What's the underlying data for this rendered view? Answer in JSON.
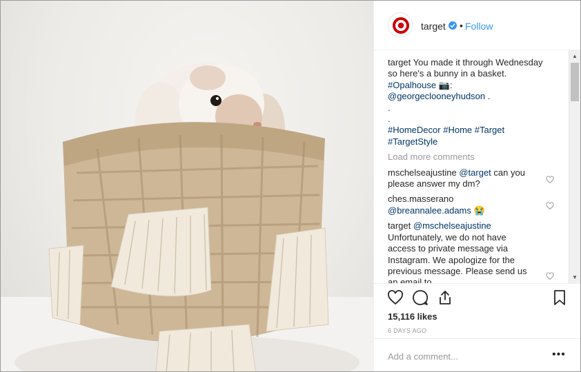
{
  "post": {
    "image_description_icon": "bunny-in-basket-photo"
  },
  "header": {
    "username": "target",
    "dot": "•",
    "follow_label": "Follow",
    "avatar_icon": "target-logo-icon",
    "verified_icon": "verified-badge-icon"
  },
  "caption": {
    "username": "target",
    "line1": "You made it through Wednesday",
    "line2": "so here's a bunny in a basket.",
    "tag_opalhouse": "#Opalhouse",
    "camera": "📷:",
    "mention_photographer": "@georgeclooneyhudson",
    "period": ".",
    "dot1": ".",
    "dot2": ".",
    "tag_homedecor": "#HomeDecor",
    "tag_home": "#Home",
    "tag_target": "#Target",
    "tag_targetstyle": "#TargetStyle"
  },
  "load_more_label": "Load more comments",
  "comments": [
    {
      "username": "mschelseajustine",
      "mention": "@target",
      "text": "can you",
      "text2": "please answer my dm?"
    },
    {
      "username": "ches.masserano",
      "mention": "@breannalee.adams",
      "emoji": "😭"
    },
    {
      "username": "target",
      "mention": "@mschelseajustine",
      "lines": [
        "Unfortunately, we do not have",
        "access to private message via",
        "Instagram. We apologize for the",
        "previous message. Please send us",
        "an email to"
      ]
    }
  ],
  "actions": {
    "like_icon": "heart-icon",
    "comment_icon": "comment-icon",
    "share_icon": "share-icon",
    "save_icon": "bookmark-icon"
  },
  "likes_text": "15,116 likes",
  "time_ago": "6 DAYS AGO",
  "add_comment": {
    "placeholder": "Add a comment...",
    "more_label": "•••"
  },
  "colors": {
    "link": "#003569",
    "follow": "#3897f0",
    "muted": "#999999",
    "brand_red": "#cc0000"
  }
}
